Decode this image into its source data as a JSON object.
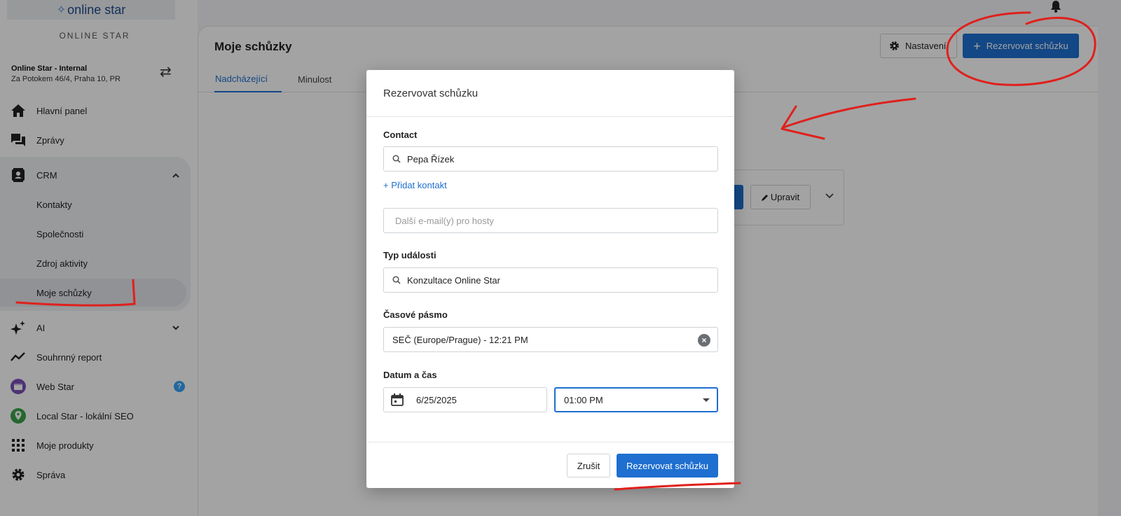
{
  "sidebar": {
    "logo_text": "online star",
    "brand": "ONLINE STAR",
    "account_name": "Online Star - Internal",
    "account_address": "Za Potokem 46/4, Praha 10, PR",
    "items": [
      {
        "label": "Hlavní panel",
        "icon": "home-icon"
      },
      {
        "label": "Zprávy",
        "icon": "chat-icon"
      },
      {
        "label": "CRM",
        "icon": "contact-card-icon"
      },
      {
        "label": "Kontakty"
      },
      {
        "label": "Společnosti"
      },
      {
        "label": "Zdroj aktivity"
      },
      {
        "label": "Moje schůzky"
      },
      {
        "label": "AI",
        "icon": "sparkle-icon"
      },
      {
        "label": "Souhrnný report",
        "icon": "trend-icon"
      },
      {
        "label": "Web Star",
        "icon": "web-star-icon"
      },
      {
        "label": "Local Star - lokální SEO",
        "icon": "location-pin-icon"
      },
      {
        "label": "Moje produkty",
        "icon": "grid-icon"
      },
      {
        "label": "Správa",
        "icon": "gear-icon"
      }
    ],
    "help_badge": "?"
  },
  "main": {
    "title": "Moje schůzky",
    "settings_label": "Nastavení",
    "book_label": "Rezervovat schůzku",
    "tabs": [
      {
        "label": "Nadcházející",
        "active": true
      },
      {
        "label": "Minulost",
        "active": false
      }
    ],
    "edit_label": "Upravit"
  },
  "modal": {
    "title": "Rezervovat schůzku",
    "contact_label": "Contact",
    "contact_value": "Pepa Řízek",
    "add_contact": "+ Přidat kontakt",
    "guests_placeholder": "Další e-mail(y) pro hosty",
    "event_type_label": "Typ události",
    "event_type_value": "Konzultace Online Star",
    "timezone_label": "Časové pásmo",
    "timezone_value": "SEČ (Europe/Prague) - 12:21 PM",
    "datetime_label": "Datum a čas",
    "date_value": "6/25/2025",
    "time_value": "01:00 PM",
    "cancel_label": "Zrušit",
    "submit_label": "Rezervovat schůzku"
  },
  "colors": {
    "accent": "#1e6fd0",
    "annotation": "#e0201c"
  }
}
